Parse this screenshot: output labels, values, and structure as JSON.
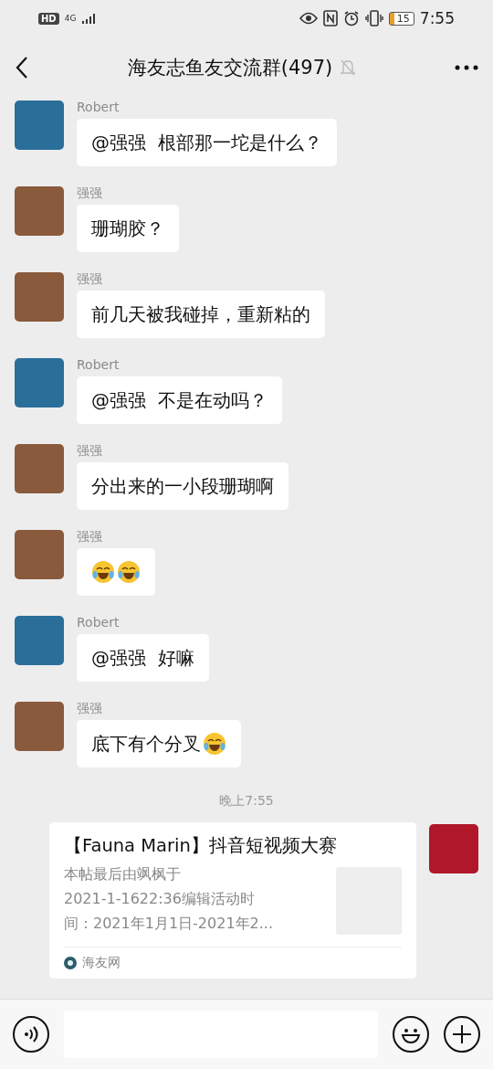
{
  "status_bar": {
    "hd": "HD",
    "network": "4G",
    "battery": "15",
    "time": "7:55"
  },
  "header": {
    "title": "海友志鱼友交流群(497)",
    "muted": true
  },
  "messages": [
    {
      "sender": "Robert",
      "color": "#2a6f9a",
      "kind": "text",
      "text": "@强强  根部那一坨是什么？"
    },
    {
      "sender": "强强",
      "color": "#8a5a3c",
      "kind": "text",
      "text": "珊瑚胶？"
    },
    {
      "sender": "强强",
      "color": "#8a5a3c",
      "kind": "text",
      "text": "前几天被我碰掉，重新粘的"
    },
    {
      "sender": "Robert",
      "color": "#2a6f9a",
      "kind": "text",
      "text": "@强强  不是在动吗？"
    },
    {
      "sender": "强强",
      "color": "#8a5a3c",
      "kind": "text",
      "text": "分出来的一小段珊瑚啊"
    },
    {
      "sender": "强强",
      "color": "#8a5a3c",
      "kind": "emoji"
    },
    {
      "sender": "Robert",
      "color": "#2a6f9a",
      "kind": "text",
      "text": "@强强  好嘛"
    },
    {
      "sender": "强强",
      "color": "#8a5a3c",
      "kind": "text_emoji",
      "text": "底下有个分叉"
    }
  ],
  "timestamp": "晚上7:55",
  "card": {
    "title": "【Fauna Marin】抖音短视频大赛",
    "lines": [
      "本帖最后由飒枫于",
      "2021-1-1622:36编辑活动时",
      "间：2021年1月1日-2021年2..."
    ],
    "source": "海友网",
    "color": "#b0182a"
  }
}
